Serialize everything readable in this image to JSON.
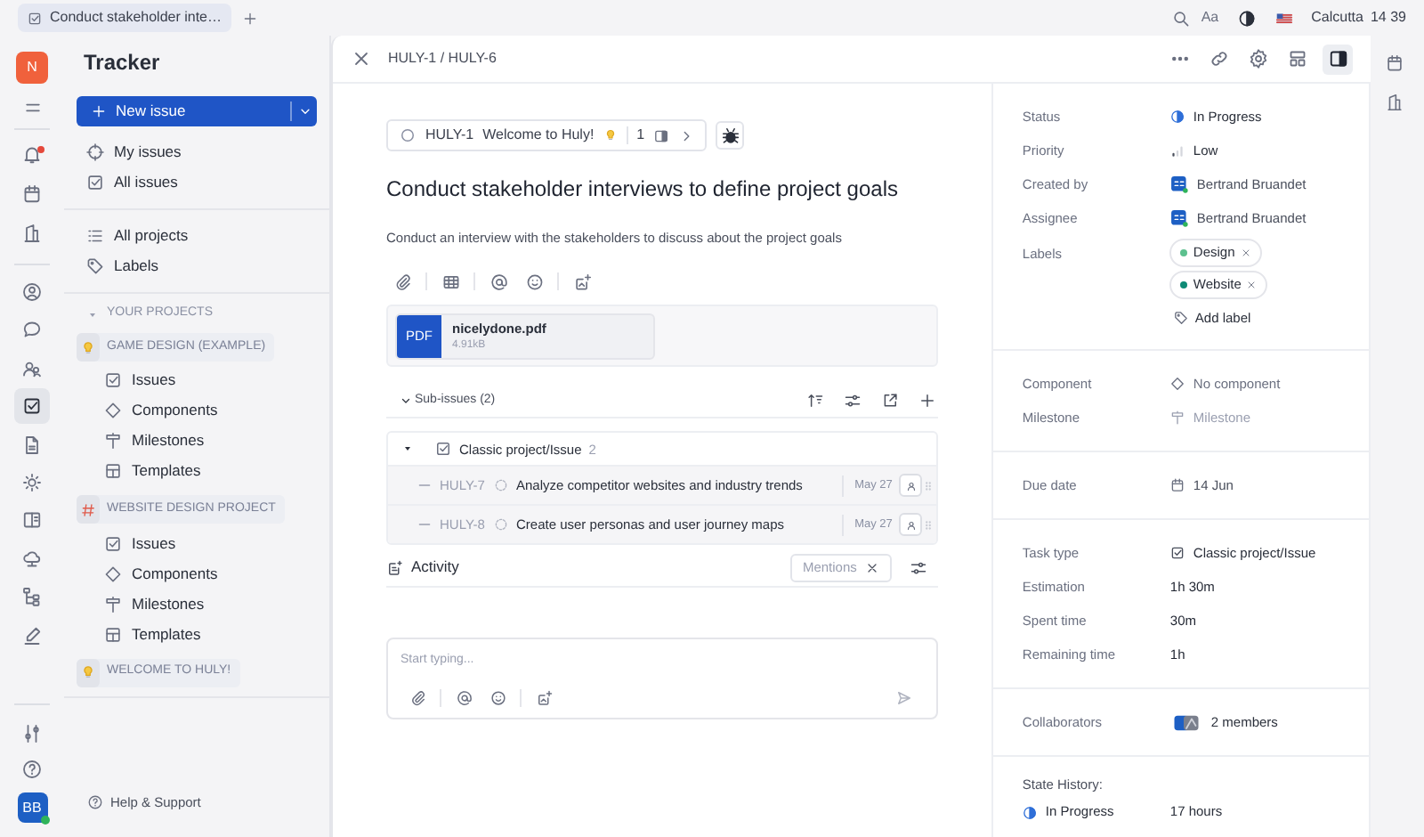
{
  "browser_tab": {
    "title": "Conduct stakeholder inte…"
  },
  "top_bar": {
    "text_size": "Aa",
    "location": "Calcutta",
    "time": "14 39"
  },
  "workspace": {
    "initial": "N"
  },
  "user": {
    "initials": "BB"
  },
  "sidebar": {
    "title": "Tracker",
    "new_issue": "New issue",
    "nav": [
      {
        "label": "My issues",
        "selected": false
      },
      {
        "label": "All issues",
        "selected": false
      }
    ],
    "nav2": [
      {
        "label": "All projects",
        "selected": false
      },
      {
        "label": "Labels",
        "selected": false
      }
    ],
    "section": "YOUR PROJECTS",
    "projects": [
      {
        "name": "GAME DESIGN (EXAMPLE)",
        "kind": "bulb",
        "children": [
          {
            "label": "Issues"
          },
          {
            "label": "Components"
          },
          {
            "label": "Milestones"
          },
          {
            "label": "Templates"
          }
        ]
      },
      {
        "name": "WEBSITE DESIGN PROJECT",
        "kind": "hash",
        "children": [
          {
            "label": "Issues"
          },
          {
            "label": "Components"
          },
          {
            "label": "Milestones"
          },
          {
            "label": "Templates"
          }
        ]
      },
      {
        "name": "WELCOME TO HULY!",
        "kind": "bulb"
      }
    ],
    "help": "Help & Support"
  },
  "issue": {
    "breadcrumb": "HULY-1 / HULY-6",
    "parent": {
      "id": "HULY-1",
      "title": "Welcome to Huly!",
      "count": "1"
    },
    "title": "Conduct stakeholder interviews to define project goals",
    "description": "Conduct an interview with the stakeholders to discuss about the project goals",
    "attachment": {
      "type": "PDF",
      "name": "nicelydone.pdf",
      "size": "4.91kB"
    },
    "sub_issues": {
      "header": "Sub-issues (2)",
      "group": {
        "label": "Classic project/Issue",
        "count": "2",
        "expanded": true
      },
      "rows": [
        {
          "id": "HULY-7",
          "title": "Analyze competitor websites and industry trends",
          "date": "May 27"
        },
        {
          "id": "HULY-8",
          "title": "Create user personas and user journey maps",
          "date": "May 27"
        }
      ]
    },
    "activity": {
      "title": "Activity",
      "filter": "Mentions",
      "placeholder": "Start typing..."
    }
  },
  "details": {
    "sections": [
      [
        {
          "label": "Status",
          "value": "In Progress",
          "kind": "status"
        },
        {
          "label": "Priority",
          "value": "Low",
          "kind": "priority"
        },
        {
          "label": "Created by",
          "value": "Bertrand Bruandet",
          "kind": "person"
        },
        {
          "label": "Assignee",
          "value": "Bertrand Bruandet",
          "kind": "person"
        },
        {
          "label": "Labels",
          "kind": "labels",
          "labels": [
            {
              "name": "Design",
              "color": "#5cc08e"
            },
            {
              "name": "Website",
              "color": "#0e8a75"
            }
          ],
          "add": "Add label"
        }
      ],
      [
        {
          "label": "Component",
          "value": "No component",
          "kind": "component"
        },
        {
          "label": "Milestone",
          "placeholder": "Milestone",
          "kind": "milestone"
        }
      ],
      [
        {
          "label": "Due date",
          "value": "14 Jun",
          "kind": "date"
        }
      ],
      [
        {
          "label": "Task type",
          "value": "Classic project/Issue",
          "kind": "task_type"
        },
        {
          "label": "Estimation",
          "value": "1h 30m",
          "kind": "time"
        },
        {
          "label": "Spent time",
          "value": "30m",
          "kind": "time"
        },
        {
          "label": "Remaining time",
          "value": "1h",
          "kind": "time"
        }
      ],
      [
        {
          "label": "Collaborators",
          "value": "2 members",
          "kind": "members"
        }
      ]
    ],
    "state_history": {
      "title": "State History:",
      "rows": [
        {
          "state": "In Progress",
          "duration": "17 hours"
        }
      ]
    }
  }
}
